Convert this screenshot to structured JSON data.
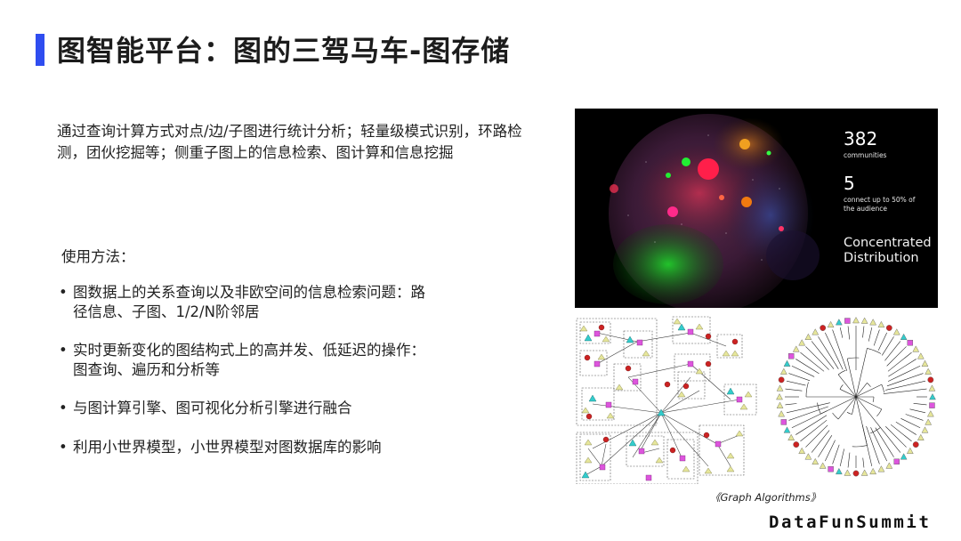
{
  "header": {
    "title": "图智能平台：图的三驾马车-图存储",
    "accent_color": "#2f4df0"
  },
  "intro": {
    "text": "通过查询计算方式对点/边/子图进行统计分析；轻量级模式识别，环路检测，团伙挖掘等；侧重子图上的信息检索、图计算和信息挖掘"
  },
  "usage": {
    "label": "使用方法：",
    "bullets": [
      "图数据上的关系查询以及非欧空间的信息检索问题：路径信息、子图、1/2/N阶邻居",
      "实时更新变化的图结构式上的高并发、低延迟的操作：图查询、遍历和分析等",
      "与图计算引擎、图可视化分析引擎进行融合",
      "利用小世界模型，小世界模型对图数据库的影响"
    ]
  },
  "community_figure": {
    "count_value": "382",
    "count_label": "communities",
    "top_value": "5",
    "top_label_line1": "connect up to 50% of",
    "top_label_line2": "the audience",
    "headline_line1": "Concentrated",
    "headline_line2": "Distribution"
  },
  "figure_caption": "《Graph Algorithms》",
  "footer": {
    "brand": "DataFunSummit"
  }
}
